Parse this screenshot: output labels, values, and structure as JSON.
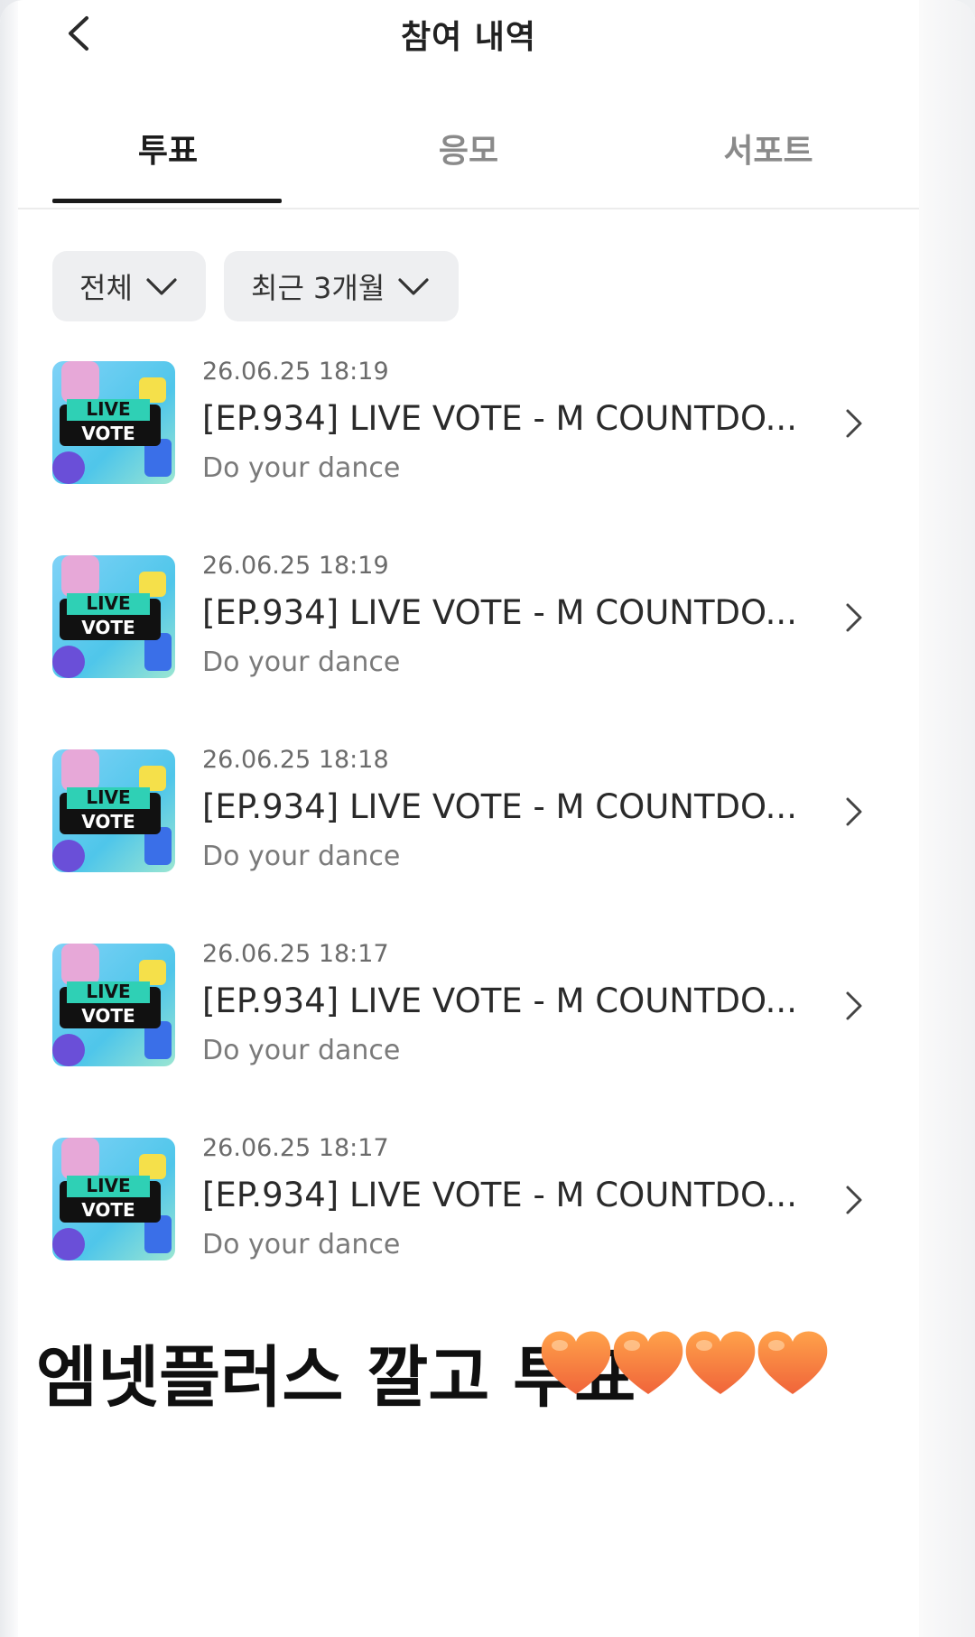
{
  "header": {
    "title": "참여 내역",
    "back_icon": "chevron-left-icon"
  },
  "tabs": [
    {
      "label": "투표",
      "active": true
    },
    {
      "label": "응모",
      "active": false
    },
    {
      "label": "서포트",
      "active": false
    }
  ],
  "filters": {
    "category": {
      "label": "전체",
      "icon": "chevron-down-icon"
    },
    "period": {
      "label": "최근 3개월",
      "icon": "chevron-down-icon"
    }
  },
  "items": [
    {
      "date": "26.06.25 18:19",
      "title": "[EP.934] LIVE VOTE - M COUNTDO...",
      "subtitle": "Do your dance",
      "thumb_text": [
        "LIVE",
        "VOTE"
      ]
    },
    {
      "date": "26.06.25 18:19",
      "title": "[EP.934] LIVE VOTE - M COUNTDO...",
      "subtitle": "Do your dance",
      "thumb_text": [
        "LIVE",
        "VOTE"
      ]
    },
    {
      "date": "26.06.25 18:18",
      "title": "[EP.934] LIVE VOTE - M COUNTDO...",
      "subtitle": "Do your dance",
      "thumb_text": [
        "LIVE",
        "VOTE"
      ]
    },
    {
      "date": "26.06.25 18:17",
      "title": "[EP.934] LIVE VOTE - M COUNTDO...",
      "subtitle": "Do your dance",
      "thumb_text": [
        "LIVE",
        "VOTE"
      ]
    },
    {
      "date": "26.06.25 18:17",
      "title": "[EP.934] LIVE VOTE - M COUNTDO...",
      "subtitle": "Do your dance",
      "thumb_text": [
        "LIVE",
        "VOTE"
      ]
    }
  ],
  "caption": {
    "text": "엠넷플러스 깔고 투표",
    "emoji": "🧡🧡🧡🧡",
    "heart_color": "#f6873a"
  }
}
